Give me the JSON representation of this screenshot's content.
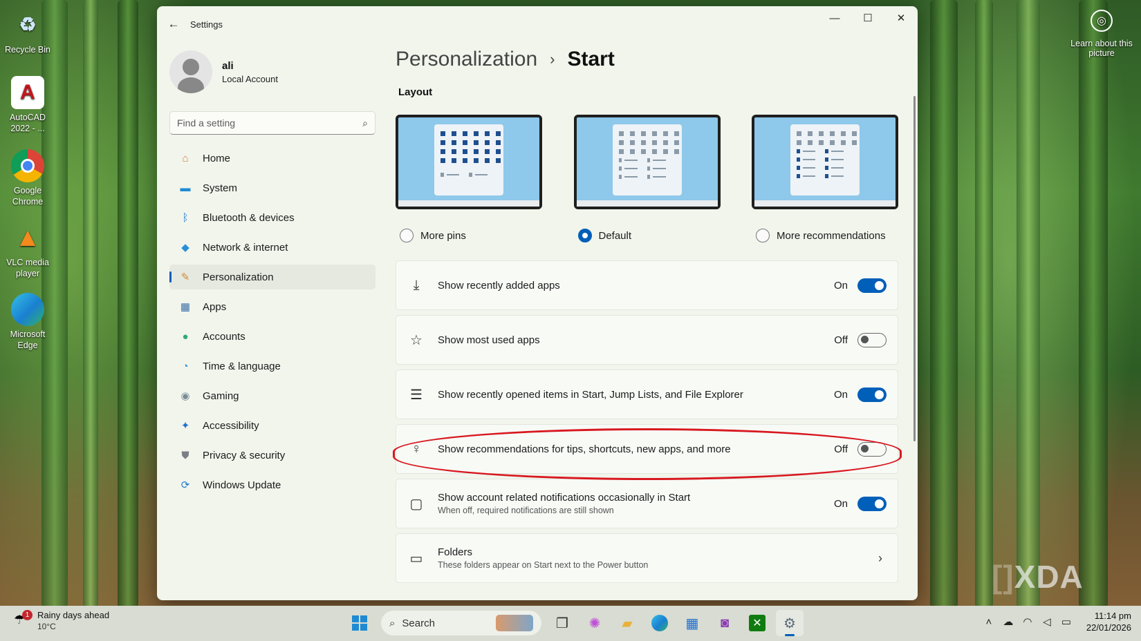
{
  "desktop": {
    "icons": [
      {
        "label": "Recycle Bin",
        "icon": "recycle-bin-icon"
      },
      {
        "label": "AutoCAD 2022 - ...",
        "icon": "autocad-icon"
      },
      {
        "label": "Google Chrome",
        "icon": "chrome-icon"
      },
      {
        "label": "VLC media player",
        "icon": "vlc-icon"
      },
      {
        "label": "Microsoft Edge",
        "icon": "edge-icon"
      }
    ],
    "learn_about": "Learn about this picture",
    "watermark": "XDA"
  },
  "window": {
    "title": "Settings",
    "controls": {
      "minimize": "—",
      "maximize": "☐",
      "close": "✕"
    }
  },
  "sidebar": {
    "user": {
      "name": "ali",
      "type": "Local Account"
    },
    "search_placeholder": "Find a setting",
    "items": [
      {
        "label": "Home",
        "glyph": "⌂",
        "color": "#e07a3a"
      },
      {
        "label": "System",
        "glyph": "▬",
        "color": "#1f8ad2"
      },
      {
        "label": "Bluetooth & devices",
        "glyph": "ᛒ",
        "color": "#1f7ad2"
      },
      {
        "label": "Network & internet",
        "glyph": "◆",
        "color": "#2a8fd8"
      },
      {
        "label": "Personalization",
        "glyph": "✎",
        "color": "#d8893a"
      },
      {
        "label": "Apps",
        "glyph": "▦",
        "color": "#3a6ea8"
      },
      {
        "label": "Accounts",
        "glyph": "●",
        "color": "#2fa87a"
      },
      {
        "label": "Time & language",
        "glyph": "◔",
        "color": "#2a8fd8"
      },
      {
        "label": "Gaming",
        "glyph": "◉",
        "color": "#7c8a96"
      },
      {
        "label": "Accessibility",
        "glyph": "✦",
        "color": "#1f6fd0"
      },
      {
        "label": "Privacy & security",
        "glyph": "⛊",
        "color": "#7a7f86"
      },
      {
        "label": "Windows Update",
        "glyph": "⟳",
        "color": "#1f7ad2"
      }
    ],
    "selected": "Personalization"
  },
  "main": {
    "breadcrumb": {
      "parent": "Personalization",
      "separator": "›",
      "current": "Start"
    },
    "layout_heading": "Layout",
    "layout_options": [
      {
        "label": "More pins",
        "selected": false
      },
      {
        "label": "Default",
        "selected": true
      },
      {
        "label": "More recommendations",
        "selected": false
      }
    ],
    "settings": [
      {
        "icon": "download-icon",
        "glyph": "⤓",
        "label": "Show recently added apps",
        "state": "On",
        "on": true
      },
      {
        "icon": "star-icon",
        "glyph": "☆",
        "label": "Show most used apps",
        "state": "Off",
        "on": false
      },
      {
        "icon": "list-icon",
        "glyph": "☰",
        "label": "Show recently opened items in Start, Jump Lists, and File Explorer",
        "state": "On",
        "on": true
      },
      {
        "icon": "lightbulb-icon",
        "glyph": "♀",
        "label": "Show recommendations for tips, shortcuts, new apps, and more",
        "state": "Off",
        "on": false
      },
      {
        "icon": "notification-icon",
        "glyph": "▢",
        "label": "Show account related notifications occasionally in Start",
        "sub": "When off, required notifications are still shown",
        "state": "On",
        "on": true
      },
      {
        "icon": "folder-icon",
        "glyph": "▭",
        "label": "Folders",
        "sub": "These folders appear on Start next to the Power button",
        "chevron": "›"
      }
    ]
  },
  "taskbar": {
    "weather": {
      "title": "Rainy days ahead",
      "temp": "10°C",
      "badge": "1"
    },
    "search_label": "Search",
    "clock": {
      "time": "11:14 pm",
      "date": "22/01/2026"
    }
  }
}
